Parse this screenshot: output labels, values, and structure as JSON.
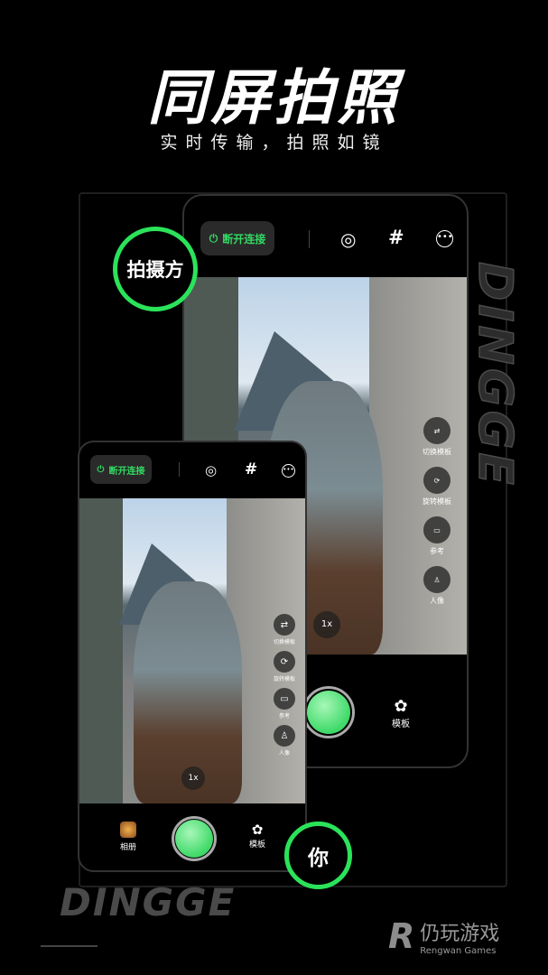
{
  "headline": "同屏拍照",
  "subheadline": "实时传输，拍照如镜",
  "brand_vertical": "DINGGE",
  "brand_bottom": "DINGGE",
  "badges": {
    "shooter": "拍摄方",
    "you": "你"
  },
  "accent_color": "#2be35a",
  "back_phone": {
    "disconnect": "断开连接",
    "toolbar_icons": [
      "power-icon",
      "brightness-icon",
      "grid-icon",
      "more-icon"
    ],
    "zoom": "1x",
    "side": [
      {
        "icon": "switch-template-icon",
        "label": "切换模板"
      },
      {
        "icon": "rotate-template-icon",
        "label": "旋转模板"
      },
      {
        "icon": "reference-icon",
        "label": "参考"
      },
      {
        "icon": "portrait-icon",
        "label": "人像"
      }
    ],
    "template_label": "模板"
  },
  "front_phone": {
    "disconnect": "断开连接",
    "zoom": "1x",
    "side": [
      {
        "icon": "switch-template-icon",
        "label": "切换模板"
      },
      {
        "icon": "rotate-template-icon",
        "label": "旋转模板"
      },
      {
        "icon": "reference-icon",
        "label": "参考"
      },
      {
        "icon": "portrait-icon",
        "label": "人像"
      }
    ],
    "album_label": "相册",
    "template_label": "模板"
  },
  "watermark": {
    "name": "仍玩游戏",
    "en": "Rengwan Games"
  }
}
